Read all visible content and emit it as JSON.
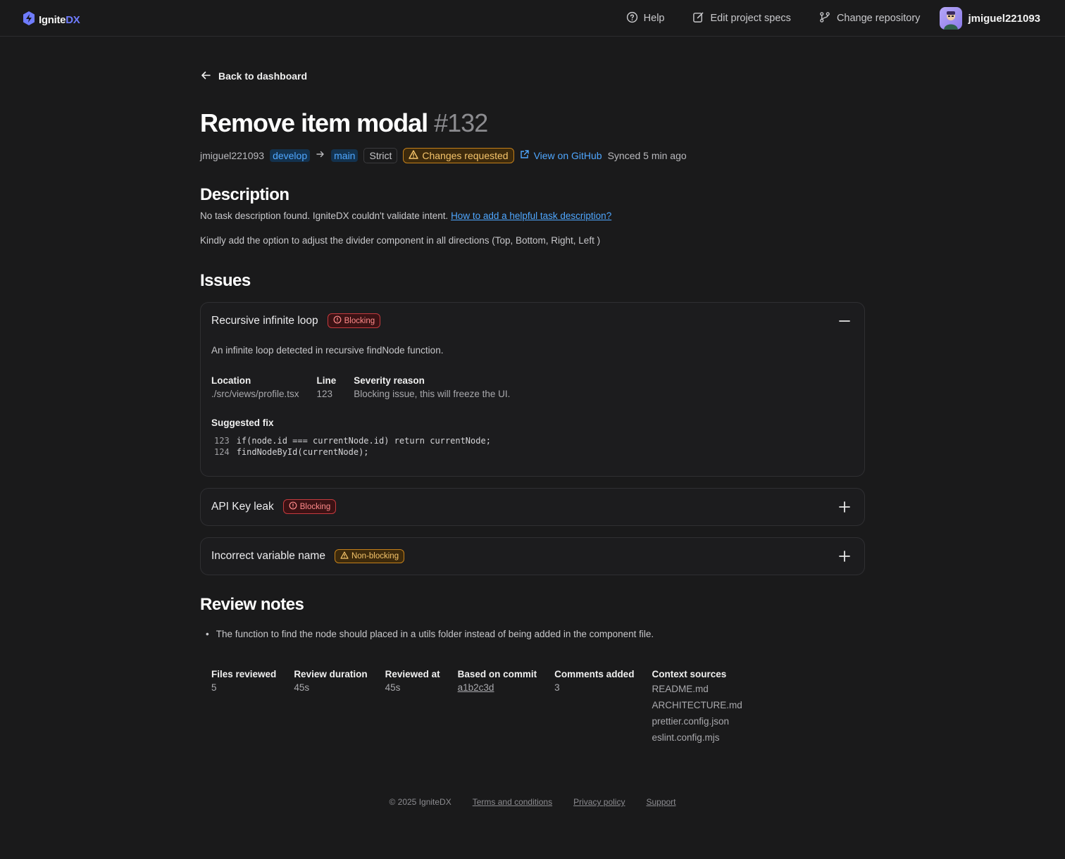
{
  "brand": {
    "name_prefix": "Ignite",
    "name_suffix": "DX"
  },
  "nav": {
    "help": "Help",
    "edit_specs": "Edit project specs",
    "change_repo": "Change repository",
    "user_name": "jmiguel221093"
  },
  "back_label": "Back to dashboard",
  "title": {
    "text": "Remove item modal",
    "number": "#132"
  },
  "meta": {
    "author": "jmiguel221093",
    "source_branch": "develop",
    "target_branch": "main",
    "mode": "Strict",
    "status": "Changes requested",
    "github_link": "View on GitHub",
    "synced": "Synced 5 min ago"
  },
  "description": {
    "heading": "Description",
    "warning": "No task description found. IgniteDX couldn't validate intent.",
    "help_link": "How to add a helpful task description?",
    "body": "Kindly add the option to adjust the divider component in all directions (Top, Bottom, Right, Left )"
  },
  "issues": {
    "heading": "Issues",
    "items": [
      {
        "title": "Recursive infinite loop",
        "badge": "Blocking",
        "expanded": true,
        "summary": "An infinite loop detected in recursive findNode function.",
        "location_label": "Location",
        "location": "./src/views/profile.tsx",
        "line_label": "Line",
        "line": "123",
        "severity_label": "Severity reason",
        "severity": "Blocking issue, this will freeze the UI.",
        "fix_label": "Suggested fix",
        "code": [
          {
            "ln": "123",
            "text": "if(node.id === currentNode.id) return currentNode;"
          },
          {
            "ln": "124",
            "text": "findNodeById(currentNode);"
          }
        ]
      },
      {
        "title": "API Key leak",
        "badge": "Blocking",
        "expanded": false
      },
      {
        "title": "Incorrect variable name",
        "badge": "Non-blocking",
        "expanded": false
      }
    ]
  },
  "review": {
    "heading": "Review notes",
    "notes": [
      "The function to find the node should placed in a utils folder instead of being added in the component file."
    ],
    "stats": {
      "files_label": "Files reviewed",
      "files": "5",
      "duration_label": "Review duration",
      "duration": "45s",
      "reviewed_at_label": "Reviewed at",
      "reviewed_at": "45s",
      "commit_label": "Based on commit",
      "commit": "a1b2c3d",
      "comments_label": "Comments added",
      "comments": "3",
      "context_label": "Context sources",
      "context": [
        "README.md",
        "ARCHITECTURE.md",
        "prettier.config.json",
        "eslint.config.mjs"
      ]
    }
  },
  "footer": {
    "copyright": "© 2025 IgniteDX",
    "terms": "Terms and conditions",
    "privacy": "Privacy policy",
    "support": "Support"
  },
  "colors": {
    "background": "#1a1a1b",
    "accent_blue": "#4fa7ff",
    "brand_purple": "#6f7cff",
    "blocking_red": "#c43a3e",
    "warning_amber": "#c4801a"
  }
}
